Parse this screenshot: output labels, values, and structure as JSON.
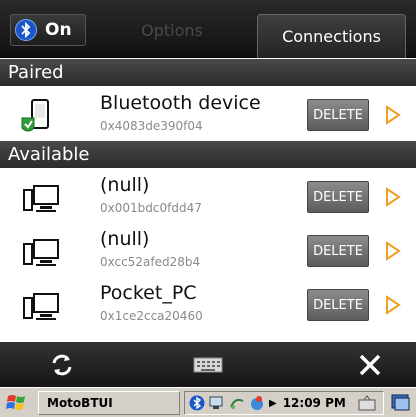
{
  "tabs": {
    "on_label": "On",
    "options_label": "Options",
    "connections_label": "Connections"
  },
  "sections": {
    "paired": "Paired",
    "available": "Available"
  },
  "delete_label": "DELETE",
  "paired_devices": [
    {
      "name": "Bluetooth device",
      "address": "0x4083de390f04",
      "icon": "paired-phone-icon"
    }
  ],
  "available_devices": [
    {
      "name": "(null)",
      "address": "0x001bdc0fdd47",
      "icon": "computer-icon"
    },
    {
      "name": "(null)",
      "address": "0xcc52afed28b4",
      "icon": "computer-icon"
    },
    {
      "name": "Pocket_PC",
      "address": "0x1ce2cca20460",
      "icon": "computer-icon"
    }
  ],
  "toolbar": {
    "refresh_icon": "refresh-icon",
    "keyboard_icon": "keyboard-icon",
    "close_icon": "close-icon"
  },
  "taskbar": {
    "app_name": "MotoBTUI",
    "clock": "12:09 PM"
  }
}
